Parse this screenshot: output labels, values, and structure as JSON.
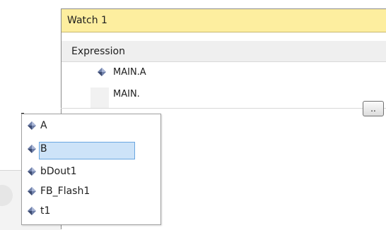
{
  "watch_window": {
    "title": "Watch 1",
    "column_header": "Expression",
    "rows": [
      {
        "expression": "MAIN.A"
      },
      {
        "expression": "MAIN."
      }
    ],
    "browse_button_label": ".."
  },
  "autocomplete": {
    "items": [
      {
        "label": "A",
        "icon": "variable-icon"
      },
      {
        "label": "B",
        "icon": "variable-icon",
        "selected": true
      },
      {
        "label": "bDout1",
        "icon": "variable-icon"
      },
      {
        "label": "FB_Flash1",
        "icon": "variable-icon"
      },
      {
        "label": "t1",
        "icon": "variable-icon"
      }
    ]
  },
  "colors": {
    "title_bar": "#fdee9f",
    "selection_fill": "#cde3f8",
    "selection_border": "#6aa6e0"
  }
}
